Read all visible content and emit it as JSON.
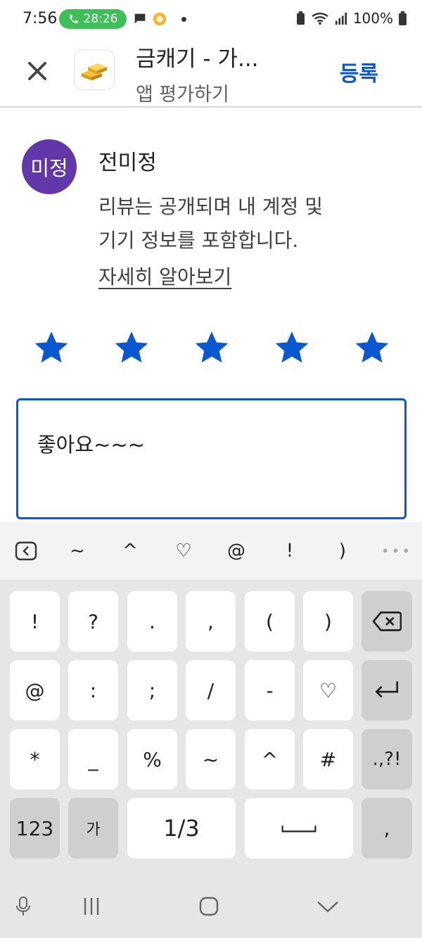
{
  "status_bar": {
    "time": "7:56",
    "call_timer": "28:26",
    "battery": "100%"
  },
  "app_bar": {
    "title": "금캐기 - 가...",
    "subtitle": "앱 평가하기",
    "post_label": "등록"
  },
  "reviewer": {
    "avatar_text": "미정",
    "name": "전미정",
    "notice_line1": "리뷰는 공개되며 내 계정 및",
    "notice_line2": "기기 정보를 포함합니다.",
    "learn_more": "자세히 알아보기"
  },
  "rating": {
    "stars": 5,
    "max": 5,
    "color": "#0b57d0"
  },
  "review": {
    "text": "좋아요~~~"
  },
  "keyboard": {
    "toolbar": [
      "~",
      "^",
      "♡",
      "@",
      "!",
      ")"
    ],
    "row1": [
      "!",
      "?",
      ".",
      ",",
      "(",
      ")"
    ],
    "row2": [
      "@",
      ":",
      ";",
      "/",
      "-",
      "♡"
    ],
    "row3": [
      "*",
      "_",
      "%",
      "~",
      "^",
      "#",
      ".,?!"
    ],
    "row4": {
      "numbers": "123",
      "lang": "가",
      "page": "1/3",
      "comma": ","
    }
  },
  "colors": {
    "accent": "#0b57d0",
    "avatar": "#6237a8",
    "call": "#3fbf5a"
  }
}
